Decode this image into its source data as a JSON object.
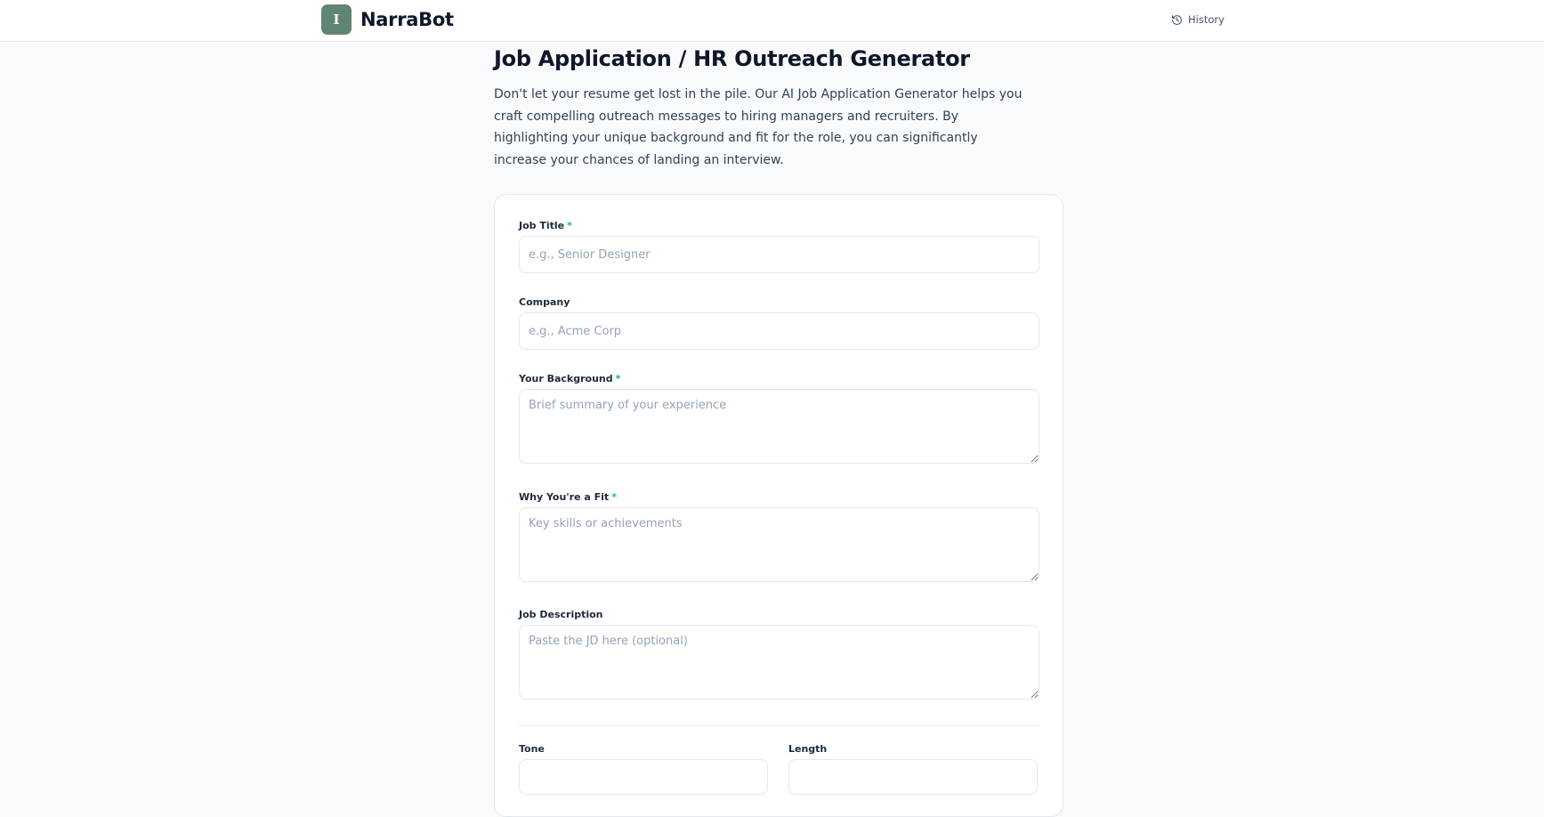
{
  "app": {
    "name": "NarraBot",
    "logo_glyph": "I"
  },
  "header": {
    "history_label": "History"
  },
  "page": {
    "title": "Job Application / HR Outreach Generator",
    "intro": "Don't let your resume get lost in the pile. Our AI Job Application Generator helps you craft compelling outreach messages to hiring managers and recruiters. By highlighting your unique background and fit for the role, you can significantly increase your chances of landing an interview."
  },
  "form": {
    "required_marker": "*",
    "job_title": {
      "label": "Job Title",
      "placeholder": "e.g., Senior Designer",
      "value": ""
    },
    "company": {
      "label": "Company",
      "placeholder": "e.g., Acme Corp",
      "value": ""
    },
    "background": {
      "label": "Your Background",
      "placeholder": "Brief summary of your experience",
      "value": ""
    },
    "fit": {
      "label": "Why You're a Fit",
      "placeholder": "Key skills or achievements",
      "value": ""
    },
    "job_description": {
      "label": "Job Description",
      "placeholder": "Paste the JD here (optional)",
      "value": ""
    },
    "tone": {
      "label": "Tone"
    },
    "length": {
      "label": "Length"
    }
  },
  "colors": {
    "accent": "#5f8673",
    "required": "#10b981",
    "background": "#f8fafc"
  },
  "icons": {
    "history": "history-clock-icon"
  }
}
